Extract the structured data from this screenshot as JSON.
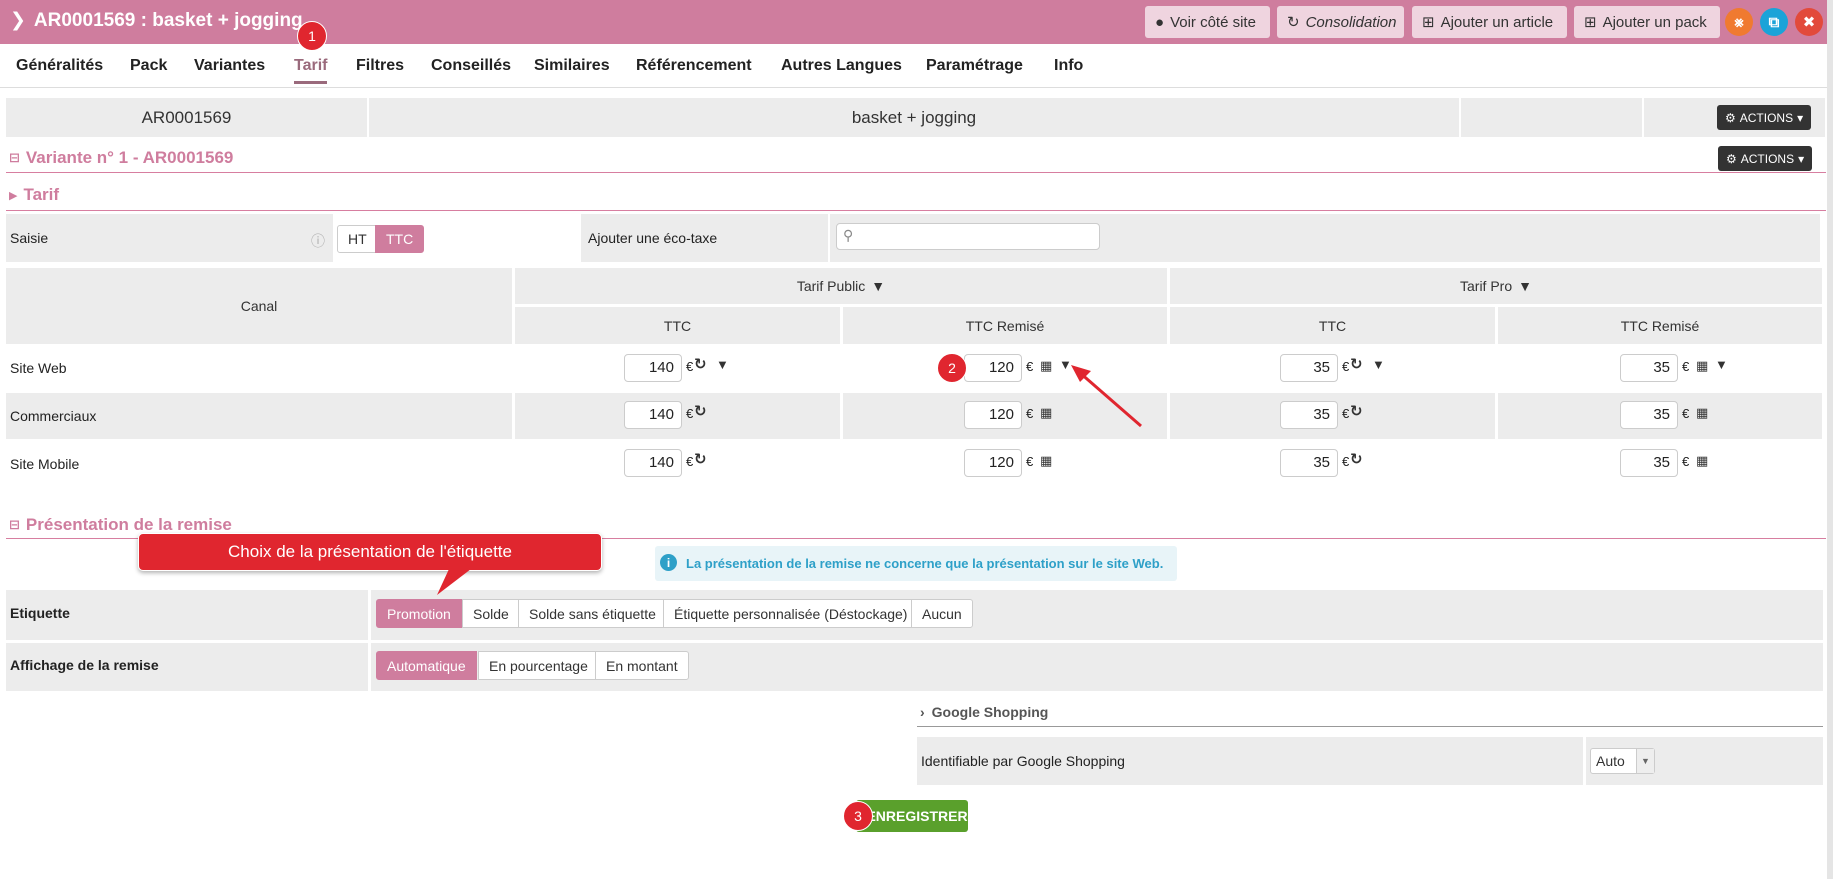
{
  "header": {
    "title": "AR0001569 : basket + jogging",
    "buttons": {
      "voir": "Voir côté site",
      "consolidation": "Consolidation",
      "ajouter_article": "Ajouter un article",
      "ajouter_pack": "Ajouter un pack"
    },
    "colors": {
      "bar": "#cf7d9e",
      "share": "#f07a30",
      "copy": "#1aa3d8",
      "close": "#e24a3b"
    }
  },
  "tabs": [
    "Généralités",
    "Pack",
    "Variantes",
    "Tarif",
    "Filtres",
    "Conseillés",
    "Similaires",
    "Référencement",
    "Autres Langues",
    "Paramétrage",
    "Info"
  ],
  "active_tab": "Tarif",
  "summary": {
    "code": "AR0001569",
    "name": "basket + jogging",
    "actions": "ACTIONS"
  },
  "variant": {
    "title": "Variante n° 1 - AR0001569",
    "actions": "ACTIONS"
  },
  "tarif": {
    "section": "Tarif",
    "saisie_label": "Saisie",
    "ht": "HT",
    "ttc": "TTC",
    "eco_label": "Ajouter une éco-taxe",
    "eco_placeholder": ""
  },
  "grid": {
    "canal": "Canal",
    "group1": "Tarif Public",
    "group2": "Tarif Pro",
    "col_ttc": "TTC",
    "col_remise": "TTC Remisé",
    "currency": "€",
    "rows": [
      {
        "name": "Site Web",
        "v": [
          "140",
          "120",
          "35",
          "35"
        ]
      },
      {
        "name": "Commerciaux",
        "v": [
          "140",
          "120",
          "35",
          "35"
        ]
      },
      {
        "name": "Site Mobile",
        "v": [
          "140",
          "120",
          "35",
          "35"
        ]
      }
    ]
  },
  "presentation": {
    "section": "Présentation de la remise",
    "callout": "Choix de la présentation de l'étiquette",
    "info": "La présentation de la remise ne concerne que la présentation sur le site Web.",
    "etiquette_label": "Etiquette",
    "etiquette_options": [
      "Promotion",
      "Solde",
      "Solde sans étiquette",
      "Étiquette personnalisée (Déstockage)",
      "Aucun"
    ],
    "affichage_label": "Affichage de la remise",
    "affichage_options": [
      "Automatique",
      "En pourcentage",
      "En montant"
    ]
  },
  "google": {
    "section": "Google Shopping",
    "label": "Identifiable par Google Shopping",
    "value": "Auto"
  },
  "save": "ENREGISTRER",
  "badges": [
    "1",
    "2",
    "3"
  ]
}
